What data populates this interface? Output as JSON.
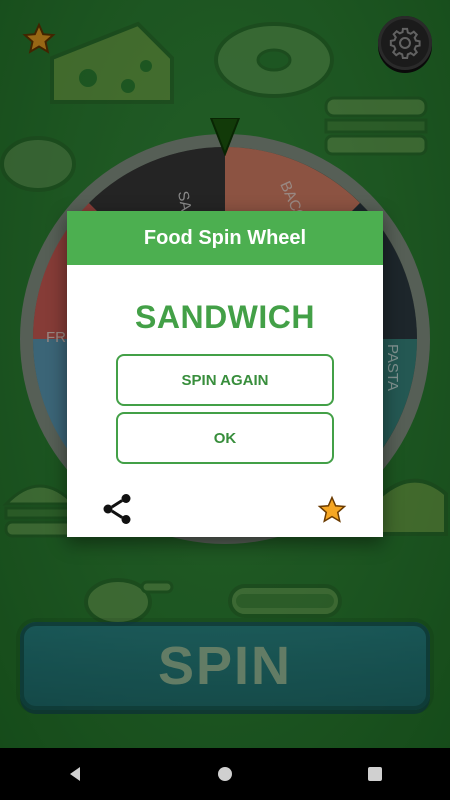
{
  "wheel": {
    "segments": [
      {
        "label": "SANDWICH",
        "color": "#3a3a3a"
      },
      {
        "label": "BACON",
        "color": "#e2876b"
      },
      {
        "label": "PASTA",
        "color": "#3b8f86"
      },
      {
        "label": "FRIES",
        "color": "#d9615a"
      }
    ]
  },
  "dialog": {
    "title": "Food Spin Wheel",
    "result": "SANDWICH",
    "spin_again_label": "SPIN AGAIN",
    "ok_label": "OK"
  },
  "spin_button": {
    "label": "SPIN"
  },
  "icons": {
    "favorite": "star-icon",
    "settings": "gear-icon",
    "share": "share-icon",
    "rate": "star-icon",
    "back": "back-triangle-icon",
    "home": "home-circle-icon",
    "recents": "recents-square-icon"
  },
  "colors": {
    "background": "#2f8a36",
    "dialog_header": "#4caf50",
    "accent_green": "#43a047",
    "spin_blue": "#1c6fae"
  }
}
